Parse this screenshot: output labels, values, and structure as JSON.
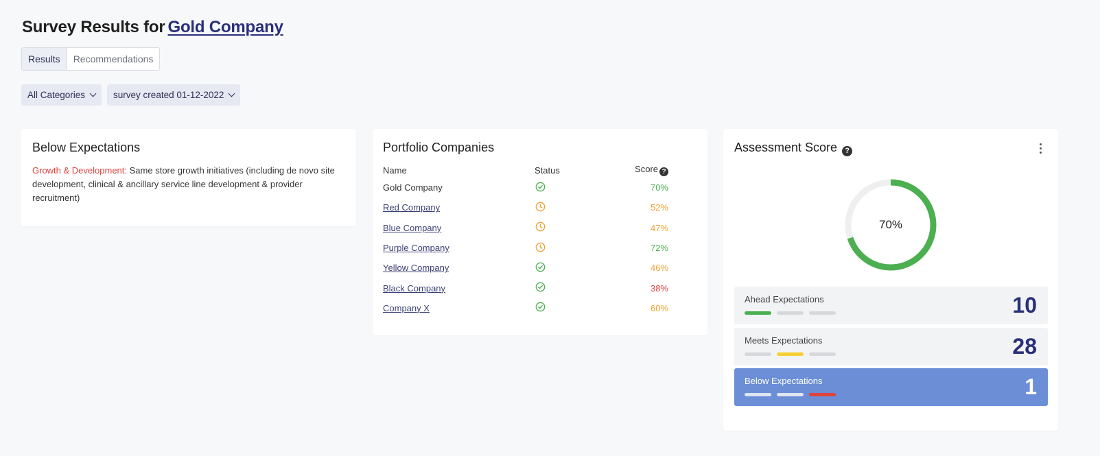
{
  "header": {
    "title_prefix": "Survey Results for",
    "company_link": "Gold Company"
  },
  "tabs": [
    {
      "label": "Results",
      "active": true
    },
    {
      "label": "Recommendations",
      "active": false
    }
  ],
  "filters": {
    "category": "All Categories",
    "survey": "survey created 01-12-2022"
  },
  "below_card": {
    "title": "Below Expectations",
    "category": "Growth & Development:",
    "text": "Same store growth initiatives (including de novo site development, clinical & ancillary service line development & provider recruitment)"
  },
  "portfolio": {
    "title": "Portfolio Companies",
    "columns": {
      "name": "Name",
      "status": "Status",
      "score": "Score"
    },
    "rows": [
      {
        "name": "Gold Company",
        "status": "check-circle-icon",
        "score": "70%",
        "score_color": "#4caf50",
        "linked": false
      },
      {
        "name": "Red Company",
        "status": "clock-circle-icon",
        "score": "52%",
        "score_color": "#f0a030",
        "linked": true
      },
      {
        "name": "Blue Company",
        "status": "clock-circle-icon",
        "score": "47%",
        "score_color": "#f0a030",
        "linked": true
      },
      {
        "name": "Purple Company",
        "status": "clock-circle-icon",
        "score": "72%",
        "score_color": "#4caf50",
        "linked": true
      },
      {
        "name": "Yellow Company",
        "status": "check-circle-icon",
        "score": "46%",
        "score_color": "#f0a030",
        "linked": true
      },
      {
        "name": "Black Company",
        "status": "check-circle-icon",
        "score": "38%",
        "score_color": "#e0433f",
        "linked": true
      },
      {
        "name": "Company X",
        "status": "check-circle-icon",
        "score": "60%",
        "score_color": "#f0a030",
        "linked": true
      }
    ]
  },
  "assessment": {
    "title": "Assessment Score",
    "score_label": "70%",
    "score_value": 70,
    "ring_color": "#4caf50",
    "track_color": "#efefef",
    "items": [
      {
        "label": "Ahead Expectations",
        "count": "10",
        "active_bar": 0,
        "bar_color": "#4caf50",
        "selected": false
      },
      {
        "label": "Meets Expectations",
        "count": "28",
        "active_bar": 1,
        "bar_color": "#f5d033",
        "selected": false
      },
      {
        "label": "Below Expectations",
        "count": "1",
        "active_bar": 2,
        "bar_color": "#e0433f",
        "selected": true
      }
    ]
  }
}
